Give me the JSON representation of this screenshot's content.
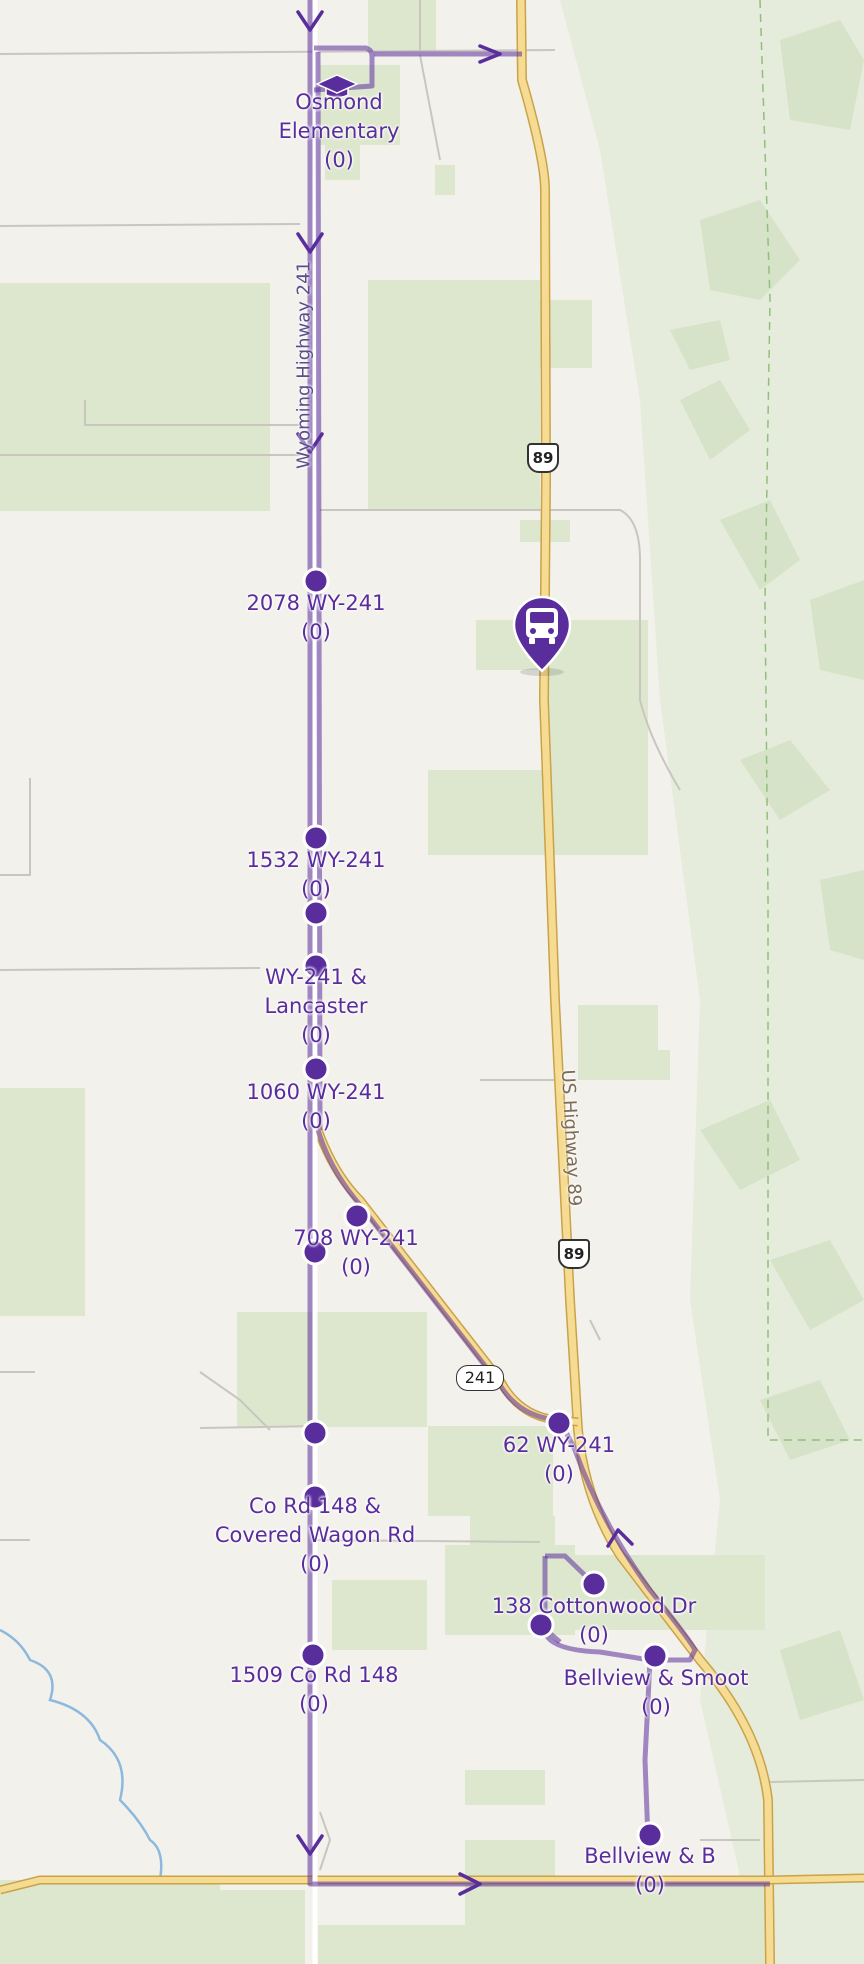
{
  "route_color": "#5a2d9c",
  "road_color": "#f6dc93",
  "park_color": "#dde7ce",
  "school": {
    "label": "Osmond\nElementary",
    "count": "(0)",
    "icon": "graduation-cap-icon"
  },
  "bus": {
    "icon": "bus-icon"
  },
  "stops": [
    {
      "name": "2078 WY-241",
      "count": "(0)"
    },
    {
      "name": "1532 WY-241",
      "count": "(0)"
    },
    {
      "name": "WY-241 &\nLancaster",
      "count": "(0)"
    },
    {
      "name": "1060 WY-241",
      "count": "(0)"
    },
    {
      "name": "708 WY-241",
      "count": "(0)"
    },
    {
      "name": "62 WY-241",
      "count": "(0)"
    },
    {
      "name": "Co Rd 148 &\nCovered Wagon Rd",
      "count": "(0)"
    },
    {
      "name": "138 Cottonwood Dr",
      "count": "(0)"
    },
    {
      "name": "1509 Co Rd 148",
      "count": "(0)"
    },
    {
      "name": "Bellview & Smoot",
      "count": "(0)"
    },
    {
      "name": "Bellview & B",
      "count": "(0)"
    }
  ],
  "roads": {
    "wy241_label": "Wyoming Highway 241",
    "us89_label": "US Highway 89",
    "us89_shield": "89",
    "wy241_shield": "241"
  }
}
